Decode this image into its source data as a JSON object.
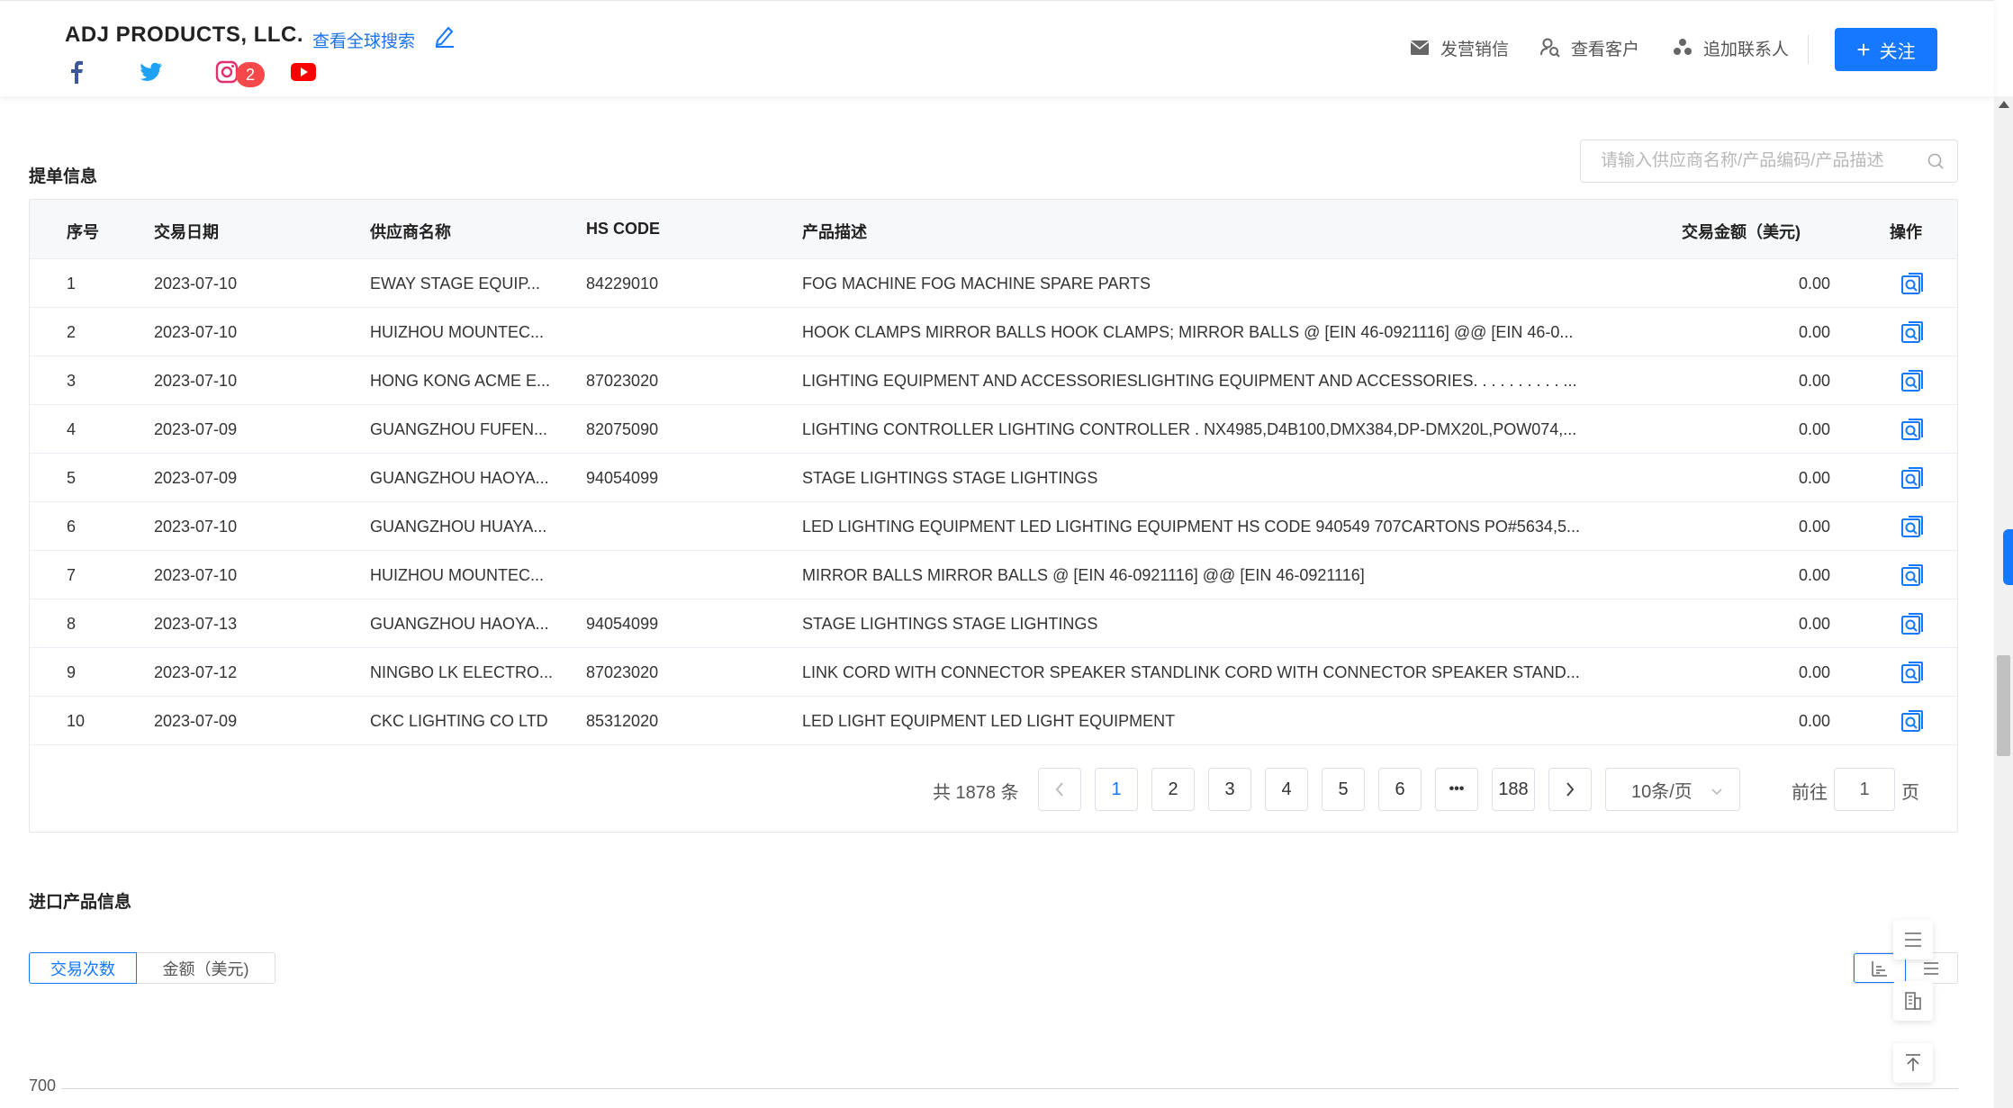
{
  "header": {
    "company": "ADJ PRODUCTS, LLC.",
    "global_search": "查看全球搜索",
    "instagram_badge": "2",
    "actions": {
      "email": "发营销信",
      "view_customer": "查看客户",
      "add_contact": "追加联系人"
    },
    "follow": "关注"
  },
  "bills": {
    "title": "提单信息",
    "search_placeholder": "请输入供应商名称/产品编码/产品描述",
    "columns": {
      "seq": "序号",
      "date": "交易日期",
      "supplier": "供应商名称",
      "hs": "HS CODE",
      "desc": "产品描述",
      "amount": "交易金额（美元)",
      "op": "操作"
    },
    "rows": [
      {
        "seq": "1",
        "date": "2023-07-10",
        "supplier": "EWAY STAGE EQUIP...",
        "hs": "84229010",
        "desc": "FOG MACHINE FOG MACHINE SPARE PARTS",
        "amount": "0.00"
      },
      {
        "seq": "2",
        "date": "2023-07-10",
        "supplier": "HUIZHOU MOUNTEC...",
        "hs": "",
        "desc": "HOOK CLAMPS MIRROR BALLS HOOK CLAMPS; MIRROR BALLS @ [EIN 46-0921116] @@ [EIN 46-0...",
        "amount": "0.00"
      },
      {
        "seq": "3",
        "date": "2023-07-10",
        "supplier": "HONG KONG ACME E...",
        "hs": "87023020",
        "desc": "LIGHTING EQUIPMENT AND ACCESSORIESLIGHTING EQUIPMENT AND ACCESSORIES. . . . . . . . . . ...",
        "amount": "0.00"
      },
      {
        "seq": "4",
        "date": "2023-07-09",
        "supplier": "GUANGZHOU FUFEN...",
        "hs": "82075090",
        "desc": "LIGHTING CONTROLLER LIGHTING CONTROLLER . NX4985,D4B100,DMX384,DP-DMX20L,POW074,...",
        "amount": "0.00"
      },
      {
        "seq": "5",
        "date": "2023-07-09",
        "supplier": "GUANGZHOU HAOYA...",
        "hs": "94054099",
        "desc": "STAGE LIGHTINGS STAGE LIGHTINGS",
        "amount": "0.00"
      },
      {
        "seq": "6",
        "date": "2023-07-10",
        "supplier": "GUANGZHOU HUAYA...",
        "hs": "",
        "desc": "LED LIGHTING EQUIPMENT LED LIGHTING EQUIPMENT HS CODE 940549 707CARTONS PO#5634,5...",
        "amount": "0.00"
      },
      {
        "seq": "7",
        "date": "2023-07-10",
        "supplier": "HUIZHOU MOUNTEC...",
        "hs": "",
        "desc": "MIRROR BALLS MIRROR BALLS @ [EIN 46-0921116] @@ [EIN 46-0921116]",
        "amount": "0.00"
      },
      {
        "seq": "8",
        "date": "2023-07-13",
        "supplier": "GUANGZHOU HAOYA...",
        "hs": "94054099",
        "desc": "STAGE LIGHTINGS STAGE LIGHTINGS",
        "amount": "0.00"
      },
      {
        "seq": "9",
        "date": "2023-07-12",
        "supplier": "NINGBO LK ELECTRO...",
        "hs": "87023020",
        "desc": "LINK CORD WITH CONNECTOR SPEAKER STANDLINK CORD WITH CONNECTOR SPEAKER STAND...",
        "amount": "0.00"
      },
      {
        "seq": "10",
        "date": "2023-07-09",
        "supplier": "CKC LIGHTING CO LTD",
        "hs": "85312020",
        "desc": "LED LIGHT EQUIPMENT LED LIGHT EQUIPMENT",
        "amount": "0.00"
      }
    ],
    "pagination": {
      "total": "共 1878 条",
      "pages": [
        "1",
        "2",
        "3",
        "4",
        "5",
        "6"
      ],
      "ellipsis": "•••",
      "last": "188",
      "current": "1",
      "page_size": "10条/页",
      "goto_prefix": "前往",
      "goto_value": "1",
      "goto_suffix": "页"
    }
  },
  "imports": {
    "title": "进口产品信息",
    "tab_count": "交易次数",
    "tab_amount": "金额（美元)",
    "y_tick": "700"
  },
  "colors": {
    "accent": "#1677ff",
    "badge": "#f5484b",
    "facebook": "#3b5998",
    "twitter": "#1da1f2",
    "instagram": "#e1306c",
    "youtube": "#ff0000"
  }
}
